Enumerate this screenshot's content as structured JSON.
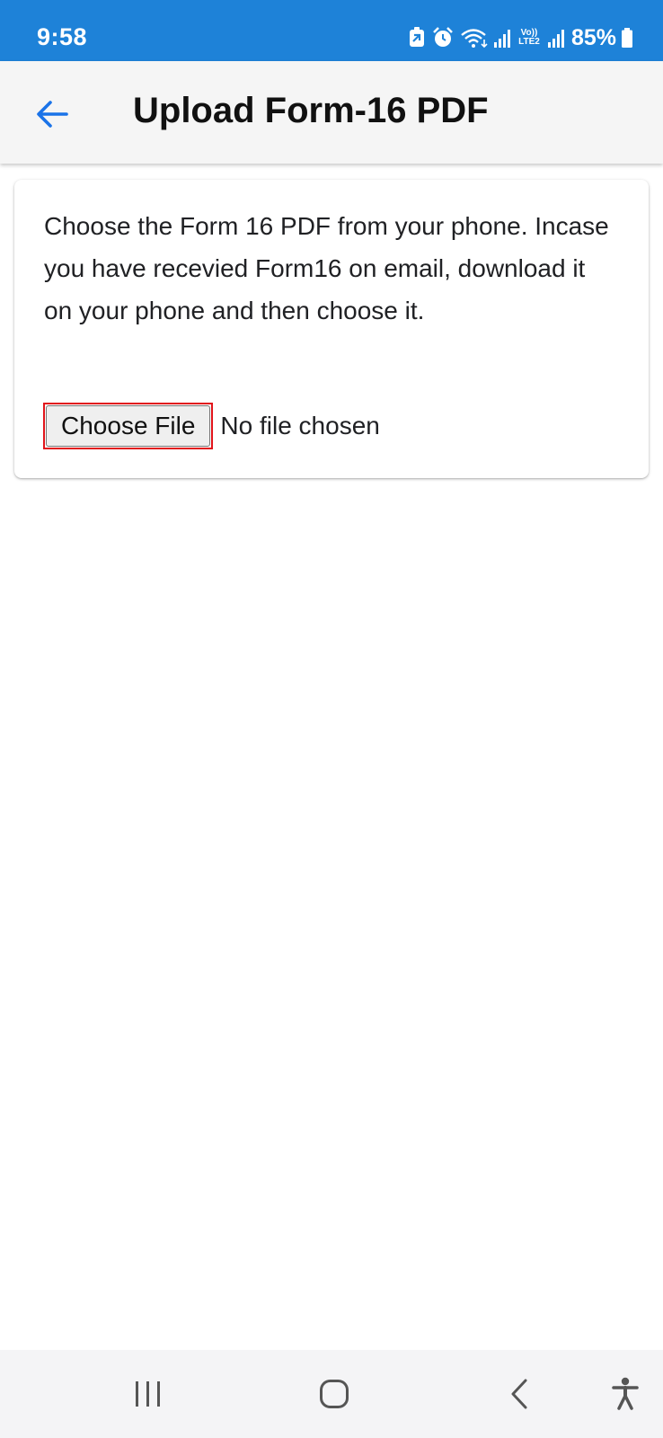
{
  "status_bar": {
    "time": "9:58",
    "volte_line1": "Vo))",
    "volte_line2": "LTE2",
    "battery_percent": "85%",
    "icons": [
      "data-saver-icon",
      "alarm-icon",
      "wifi-icon",
      "signal-icon",
      "volte-icon",
      "signal-icon",
      "battery-icon"
    ]
  },
  "app_bar": {
    "back_icon": "arrow-left-icon",
    "title": "Upload Form-16 PDF"
  },
  "card": {
    "instructions": "Choose the Form 16 PDF from your phone. Incase you have recevied Form16 on email, download it on your phone and then choose it.",
    "choose_file_label": "Choose File",
    "file_status": "No file chosen"
  },
  "nav_bar": {
    "icons": [
      "recent-apps-icon",
      "home-icon",
      "back-chevron-icon",
      "accessibility-icon"
    ]
  },
  "colors": {
    "status_bar": "#1e82d8",
    "accent": "#1a73e8",
    "highlight": "#e1141a",
    "app_bar": "#f5f5f5",
    "nav_bar": "#f4f4f6"
  }
}
